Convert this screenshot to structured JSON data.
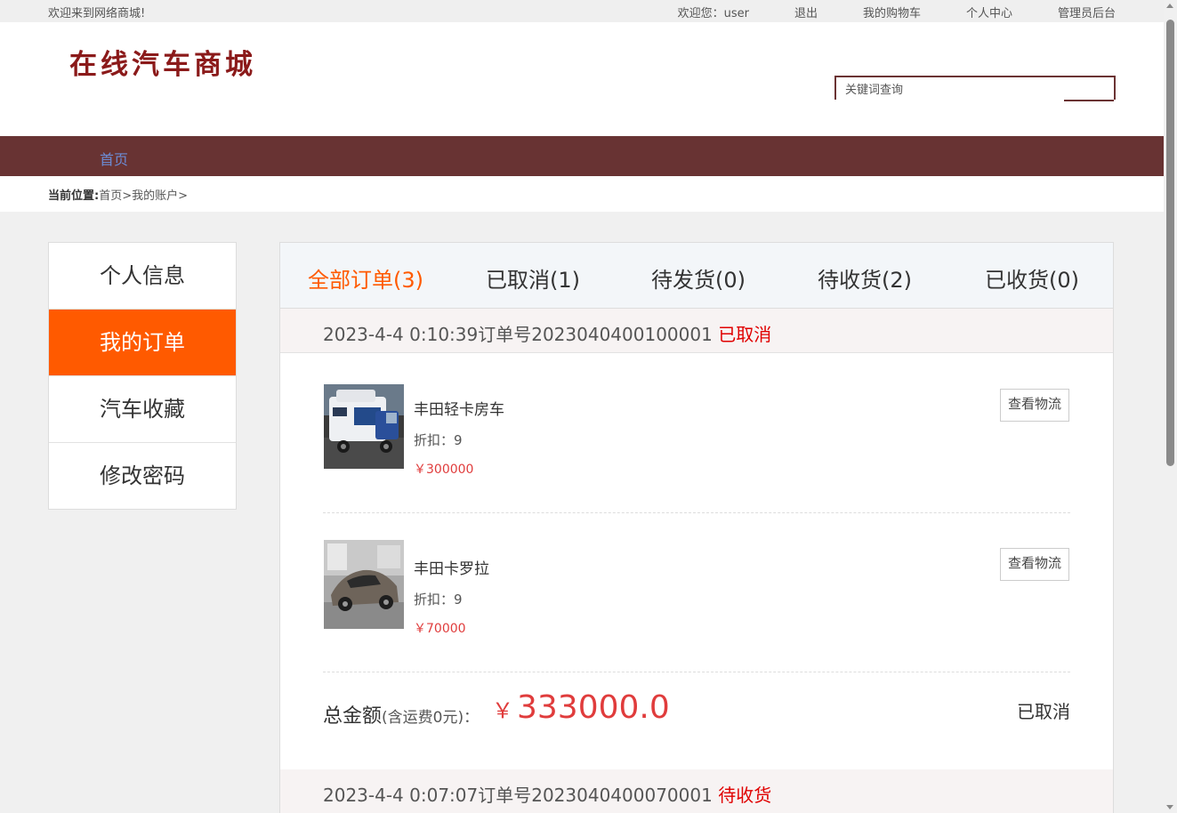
{
  "topbar": {
    "welcome": "欢迎来到网络商城!",
    "user_greeting": "欢迎您：user",
    "logout": "退出",
    "cart": "我的购物车",
    "profile": "个人中心",
    "admin": "管理员后台"
  },
  "header": {
    "logo": "在线汽车商城",
    "search_placeholder": "关键词查询"
  },
  "nav": {
    "home": "首页"
  },
  "breadcrumb": {
    "label": "当前位置:",
    "path": "首页>我的账户>"
  },
  "sidebar": {
    "items": [
      {
        "label": "个人信息"
      },
      {
        "label": "我的订单"
      },
      {
        "label": "汽车收藏"
      },
      {
        "label": "修改密码"
      }
    ]
  },
  "tabs": [
    {
      "label": "全部订单(3)"
    },
    {
      "label": "已取消(1)"
    },
    {
      "label": "待发货(0)"
    },
    {
      "label": "待收货(2)"
    },
    {
      "label": "已收货(0)"
    }
  ],
  "orders": [
    {
      "header": "2023-4-4 0:10:39订单号2023040400100001",
      "status": "已取消",
      "items": [
        {
          "name": "丰田轻卡房车",
          "discount": "折扣：9",
          "price": "￥300000",
          "logistics": "查看物流"
        },
        {
          "name": "丰田卡罗拉",
          "discount": "折扣：9",
          "price": "￥70000",
          "logistics": "查看物流"
        }
      ],
      "total_label": "总金额",
      "total_note": "(含运费0元)：",
      "currency": "￥",
      "total_amount": "333000.0",
      "total_status": "已取消"
    },
    {
      "header": "2023-4-4 0:07:07订单号2023040400070001",
      "status": "待收货"
    }
  ],
  "colors": {
    "nav_bg": "#683333",
    "accent_orange": "#ff5a00",
    "price_red": "#e03c3c",
    "logo_red": "#8b1a1a"
  }
}
